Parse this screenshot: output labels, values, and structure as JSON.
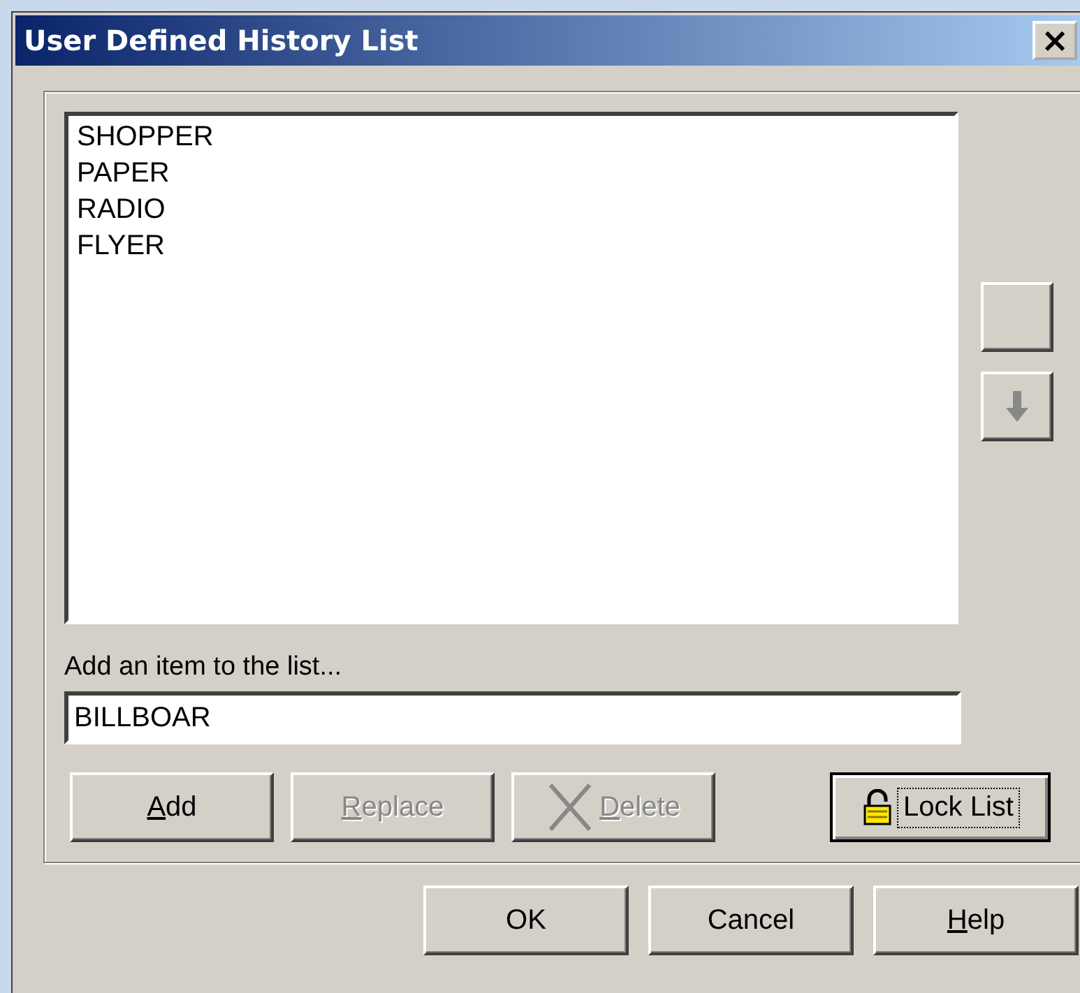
{
  "window": {
    "title": "User Defined History List",
    "close": "×"
  },
  "list": {
    "items": [
      "SHOPPER",
      "PAPER",
      "RADIO",
      "FLYER"
    ]
  },
  "side_buttons": [
    {
      "kind": "blank"
    },
    {
      "kind": "down",
      "disabled": true
    }
  ],
  "field": {
    "label": "Add an item to the list...",
    "value": "BILLBOAR"
  },
  "actions": [
    {
      "label": "Add",
      "underlined": true,
      "kind": "plain",
      "disabled": false,
      "focused": false
    },
    {
      "label": "Replace",
      "underlined": true,
      "kind": "plain",
      "disabled": true,
      "focused": false
    },
    {
      "label": "Delete",
      "underlined": true,
      "kind": "delete",
      "disabled": true,
      "focused": false
    },
    {
      "label": "Lock List",
      "kind": "lock",
      "disabled": false,
      "focused": true
    }
  ],
  "buttons": [
    {
      "label": "OK"
    },
    {
      "label": "Cancel"
    },
    {
      "label": "Help",
      "underlined": true
    }
  ]
}
